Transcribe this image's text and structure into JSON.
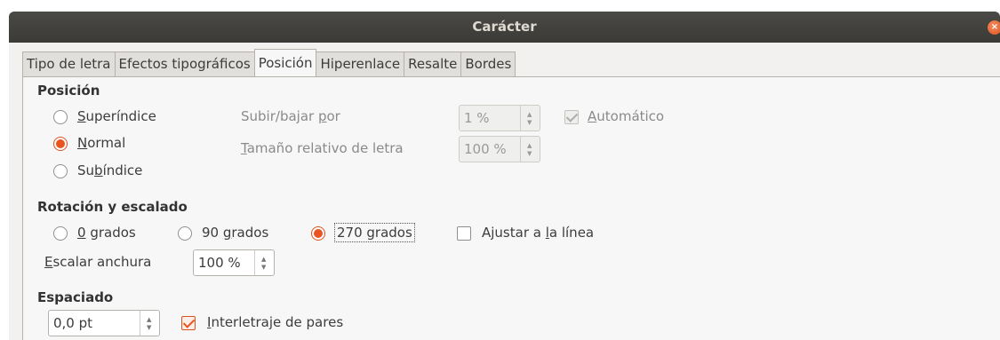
{
  "window": {
    "title": "Carácter",
    "close_symbol": "×"
  },
  "tabs": [
    {
      "label": "Tipo de letra"
    },
    {
      "label": "Efectos tipográficos"
    },
    {
      "label": "Posición"
    },
    {
      "label": "Hiperenlace"
    },
    {
      "label": "Resalte"
    },
    {
      "label": "Bordes"
    }
  ],
  "active_tab": "Posición",
  "position": {
    "heading": "Posición",
    "superindice": {
      "u": "S",
      "rest": "uperíndice"
    },
    "normal": {
      "u": "N",
      "rest": "ormal"
    },
    "subindice": {
      "pre": "Su",
      "u": "b",
      "rest": "índice"
    },
    "selected": "Normal",
    "raise_lower": {
      "pre": "Subir/bajar ",
      "u": "p",
      "rest": "or",
      "value": "1 %"
    },
    "relative_size": {
      "u": "T",
      "rest": "amaño relativo de letra",
      "value": "100 %"
    },
    "automatic": {
      "u": "A",
      "rest": "utomático",
      "checked": true
    }
  },
  "rotation": {
    "heading": "Rotación y escalado",
    "deg0": {
      "u": "0",
      "rest": " grados"
    },
    "deg90": {
      "pre": "90 ",
      "u": "g",
      "rest": "rados"
    },
    "deg270": {
      "label": "270 grados"
    },
    "selected": "270 grados",
    "fit_to_line": {
      "pre": "Ajustar a ",
      "u": "l",
      "rest": "a línea",
      "checked": false
    },
    "scale_width": {
      "u": "E",
      "rest": "scalar anchura",
      "value": "100 %"
    }
  },
  "spacing": {
    "heading": "Espaciado",
    "value": "0,0 pt",
    "kerning": {
      "u": "I",
      "rest": "nterletraje de pares",
      "checked": true
    }
  },
  "icons": {
    "spin_up": "▲",
    "spin_down": "▼"
  },
  "colors": {
    "accent": "#e95420",
    "titlebar": "#3c3b37"
  }
}
